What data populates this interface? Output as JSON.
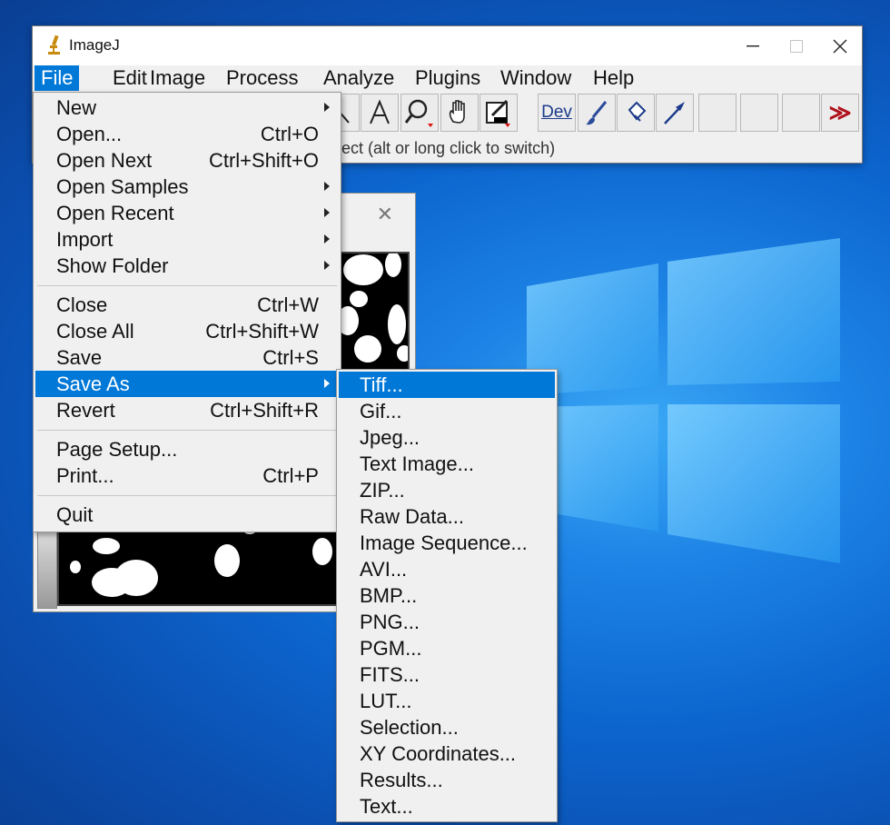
{
  "window": {
    "title": "ImageJ"
  },
  "menubar": [
    "File",
    "Edit",
    "Image",
    "Process",
    "Analyze",
    "Plugins",
    "Window",
    "Help"
  ],
  "toolbar": {
    "dev_label": "Dev",
    "more_label": "≫"
  },
  "status": "ect (alt or long click to switch)",
  "file_menu": {
    "items": [
      {
        "label": "New",
        "shortcut": ""
      },
      {
        "label": "Open...",
        "shortcut": "Ctrl+O"
      },
      {
        "label": "Open Next",
        "shortcut": "Ctrl+Shift+O"
      },
      {
        "label": "Open Samples",
        "shortcut": ""
      },
      {
        "label": "Open Recent",
        "shortcut": ""
      },
      {
        "label": "Import",
        "shortcut": ""
      },
      {
        "label": "Show Folder",
        "shortcut": ""
      },
      {
        "label": "Close",
        "shortcut": "Ctrl+W"
      },
      {
        "label": "Close All",
        "shortcut": "Ctrl+Shift+W"
      },
      {
        "label": "Save",
        "shortcut": "Ctrl+S"
      },
      {
        "label": "Save As",
        "shortcut": ""
      },
      {
        "label": "Revert",
        "shortcut": "Ctrl+Shift+R"
      },
      {
        "label": "Page Setup...",
        "shortcut": ""
      },
      {
        "label": "Print...",
        "shortcut": "Ctrl+P"
      },
      {
        "label": "Quit",
        "shortcut": ""
      }
    ]
  },
  "save_as_menu": {
    "items": [
      "Tiff...",
      "Gif...",
      "Jpeg...",
      "Text Image...",
      "ZIP...",
      "Raw Data...",
      "Image Sequence...",
      "AVI...",
      "BMP...",
      "PNG...",
      "PGM...",
      "FITS...",
      "LUT...",
      "Selection...",
      "XY Coordinates...",
      "Results...",
      "Text..."
    ]
  },
  "colors": {
    "highlight": "#0078d7",
    "menu_bg": "#f0f0f0"
  }
}
